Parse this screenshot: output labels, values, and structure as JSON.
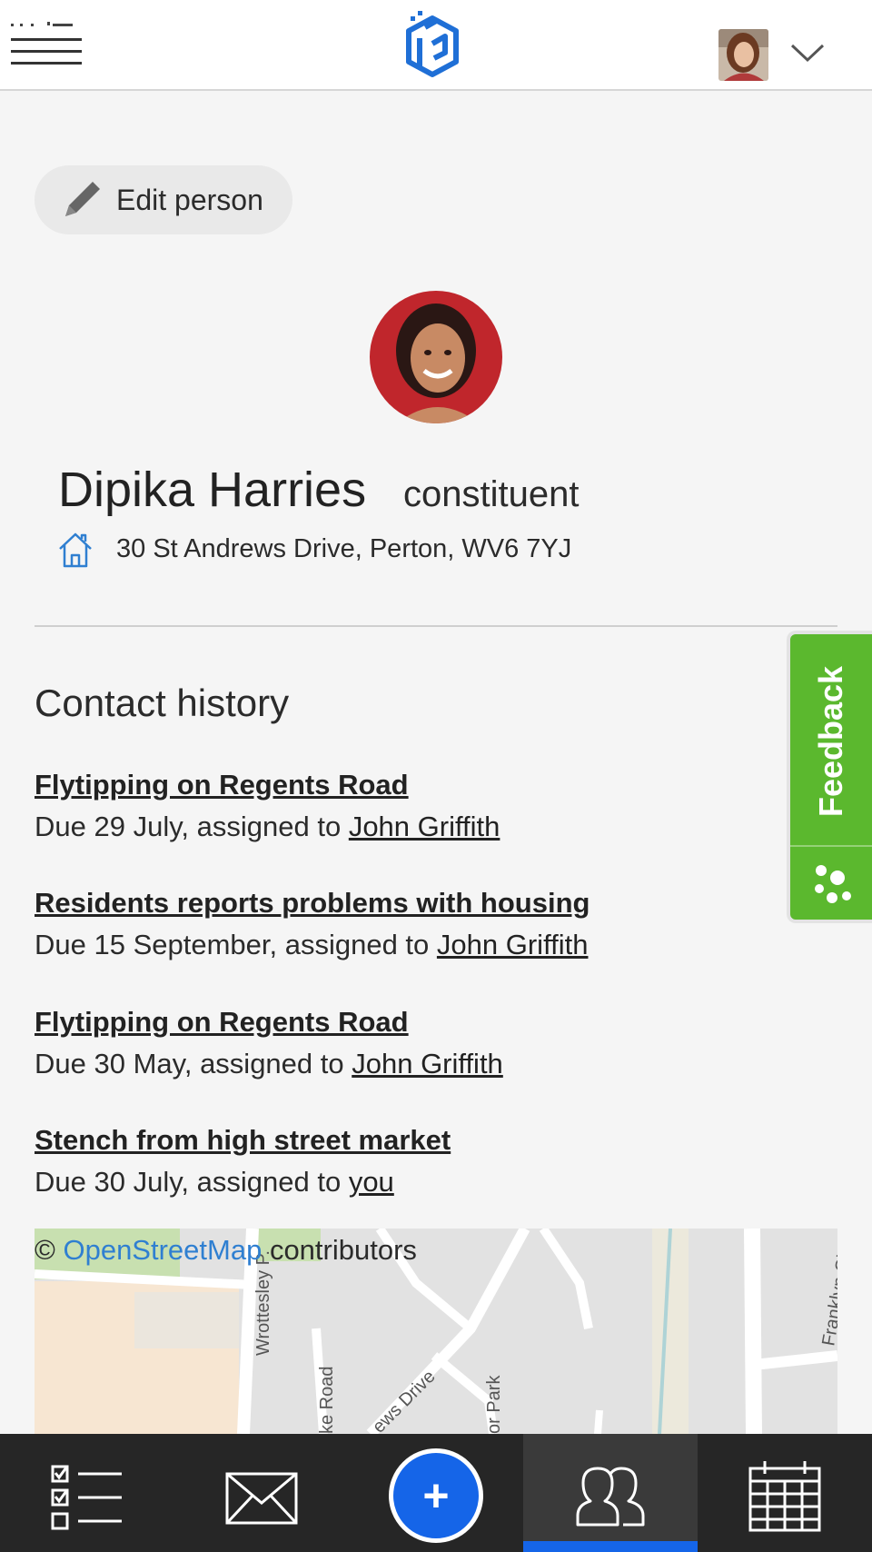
{
  "header": {
    "menu_icon": "hamburger-menu-icon",
    "logo_icon": "app-logo-icon",
    "avatar": "user-avatar",
    "dropdown_icon": "chevron-down-icon"
  },
  "edit_person": {
    "label": "Edit person",
    "icon": "pencil-icon"
  },
  "person": {
    "name": "Dipika Harries",
    "role": "constituent",
    "address": "30 St Andrews Drive, Perton, WV6 7YJ",
    "address_icon": "home-icon"
  },
  "contact_history": {
    "title": "Contact history",
    "items": [
      {
        "title": "Flytipping on Regents Road",
        "meta": "Due 29 July, assigned to ",
        "assignee": "John Griffith"
      },
      {
        "title": "Residents reports problems with housing",
        "meta": "Due 15 September, assigned to ",
        "assignee": "John Griffith"
      },
      {
        "title": "Flytipping on Regents Road",
        "meta": "Due 30 May, assigned to ",
        "assignee": "John Griffith"
      },
      {
        "title": "Stench from high street market",
        "meta": "Due 30 July, assigned to ",
        "assignee": "you"
      }
    ]
  },
  "feedback": {
    "label": "Feedback",
    "icon": "feedback-dots-icon",
    "color": "#5bb82e"
  },
  "map": {
    "attribution_prefix": "© ",
    "attribution_link": "OpenStreetMap",
    "attribution_suffix": " contributors",
    "street_labels": [
      "Wrottesley P.",
      "ke Road",
      "ews Drive",
      "or Park",
      "Franklyn Clo."
    ]
  },
  "bottom_nav": {
    "items": [
      {
        "icon": "task-checklist-icon",
        "active": false
      },
      {
        "icon": "mail-envelope-icon",
        "active": false
      },
      {
        "icon": "add-plus-icon",
        "label": "+",
        "active": false
      },
      {
        "icon": "people-icon",
        "active": true
      },
      {
        "icon": "calendar-icon",
        "active": false
      }
    ],
    "accent": "#1565e8"
  }
}
